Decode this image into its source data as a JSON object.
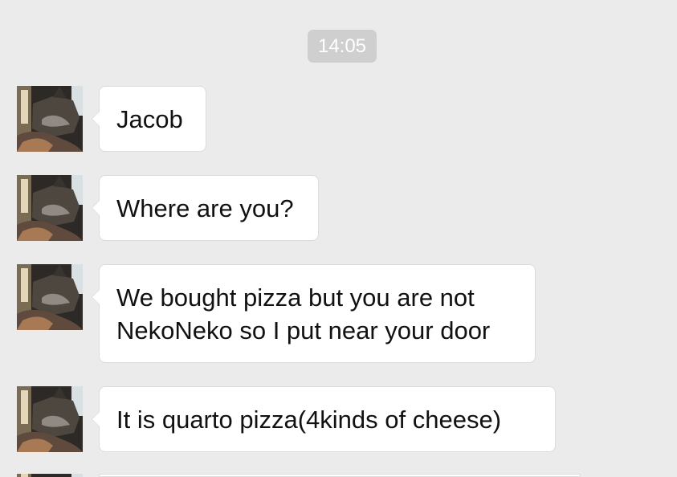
{
  "chat": {
    "timestamp": "14:05",
    "avatar": {
      "icon": "sender-avatar-cat-photo"
    },
    "messages": [
      {
        "text": "Jacob"
      },
      {
        "text": "Where are you?"
      },
      {
        "text": "We bought pizza but you are not\nNekoNeko so I put near your door"
      },
      {
        "text": "It is quarto pizza(4kinds of cheese)"
      }
    ],
    "colors": {
      "background": "#ebebeb",
      "bubble": "#ffffff",
      "timestamp_background": "#cfcfcf",
      "text": "#111111"
    }
  }
}
